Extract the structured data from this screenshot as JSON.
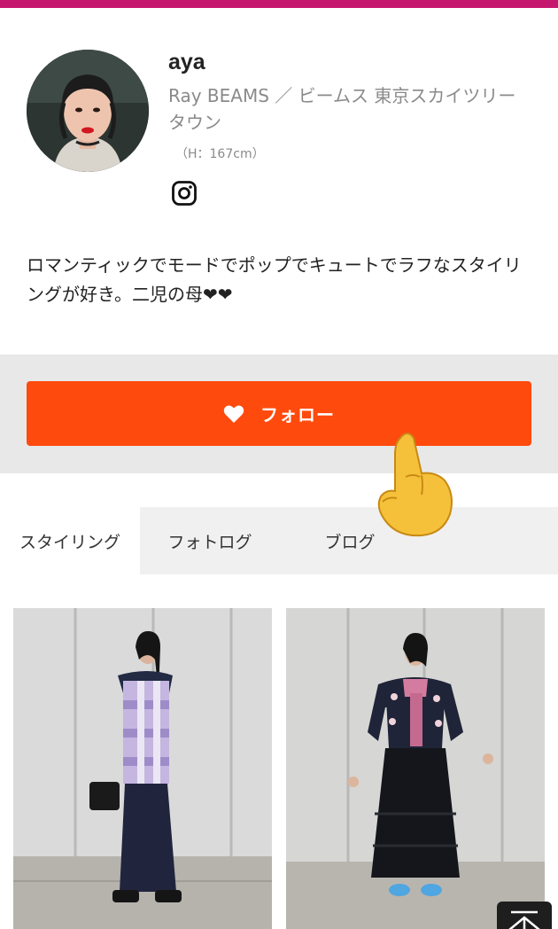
{
  "profile": {
    "username": "aya",
    "shop": "Ray BEAMS ／ ビームス 東京スカイツリータウン",
    "height": "（H：167cm）",
    "instagram_icon": "instagram-icon",
    "bio": "ロマンティックでモードでポップでキュートでラフなスタイリングが好き。二児の母❤❤"
  },
  "follow": {
    "label": "フォロー",
    "icon": "heart-icon",
    "button_color": "#ff4a0e"
  },
  "tabs": [
    {
      "label": "スタイリング",
      "active": true
    },
    {
      "label": "フォトログ",
      "active": false
    },
    {
      "label": "ブログ",
      "active": false
    }
  ],
  "photos": [
    {
      "icon": "styling-photo"
    },
    {
      "icon": "styling-photo"
    }
  ],
  "colors": {
    "accent": "#c6176e",
    "follow_button": "#ff4a0e",
    "tab_bar": "#f0f0f0",
    "follow_area": "#e8e8e8"
  },
  "scroll_top": {
    "icon": "arrow-up-icon"
  }
}
